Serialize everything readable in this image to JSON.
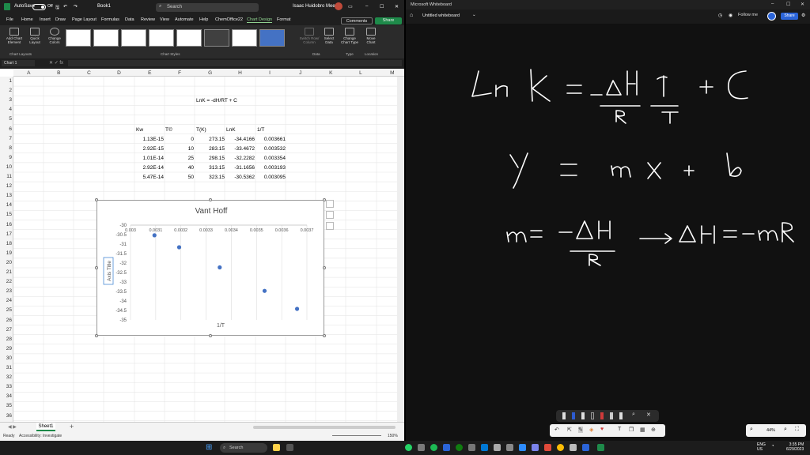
{
  "excel": {
    "autosave_label": "AutoSave",
    "toggle_state": "Off",
    "book_title": "Book1",
    "search_placeholder": "Search",
    "user_name": "Isaac Huidobro Meezs",
    "menu": [
      "File",
      "Home",
      "Insert",
      "Draw",
      "Page Layout",
      "Formulas",
      "Data",
      "Review",
      "View",
      "Automate",
      "Help",
      "ChemOffice22",
      "Chart Design",
      "Format"
    ],
    "active_menu": "Chart Design",
    "comments_label": "Comments",
    "share_label": "Share",
    "ribbon": {
      "add_chart_element": "Add Chart\nElement",
      "quick_layout": "Quick\nLayout",
      "change_colors": "Change\nColors",
      "switch_row_col": "Switch Row/\nColumn",
      "select_data": "Select\nData",
      "change_chart_type": "Change\nChart Type",
      "move_chart": "Move\nChart",
      "groups": [
        "Chart Layouts",
        "Chart Styles",
        "Data",
        "Type",
        "Location"
      ]
    },
    "namebox": "Chart 1",
    "columns": [
      "A",
      "B",
      "C",
      "D",
      "E",
      "F",
      "G",
      "H",
      "I",
      "J",
      "K",
      "L",
      "M"
    ],
    "rows": [
      "1",
      "2",
      "3",
      "4",
      "5",
      "6",
      "7",
      "8",
      "9",
      "10",
      "11",
      "12",
      "13",
      "14",
      "15",
      "16",
      "17",
      "18",
      "19",
      "20",
      "21",
      "22",
      "23",
      "24",
      "25",
      "26",
      "27",
      "28",
      "29",
      "30",
      "31",
      "32",
      "33",
      "34",
      "35",
      "36"
    ],
    "equation": "LnK = -dH/RT + C",
    "table_headers": [
      "Kw",
      "T©",
      "T(K)",
      "LnK",
      "1/T"
    ],
    "table_rows": [
      [
        "1.13E-15",
        "0",
        "273.15",
        "-34.4166",
        "0.003661"
      ],
      [
        "2.92E-15",
        "10",
        "283.15",
        "-33.4672",
        "0.003532"
      ],
      [
        "1.01E-14",
        "25",
        "298.15",
        "-32.2282",
        "0.003354"
      ],
      [
        "2.92E-14",
        "40",
        "313.15",
        "-31.1656",
        "0.003193"
      ],
      [
        "5.47E-14",
        "50",
        "323.15",
        "-30.5362",
        "0.003095"
      ]
    ],
    "sheet_tab": "Sheet1",
    "status_ready": "Ready",
    "status_accessibility": "Accessibility: Investigate",
    "zoom": "150%"
  },
  "chart_data": {
    "type": "scatter",
    "title": "Vant Hoff",
    "xlabel": "1/T",
    "ylabel": "Axis Title",
    "x_ticks": [
      "0.003",
      "0.0031",
      "0.0032",
      "0.0033",
      "0.0034",
      "0.0035",
      "0.0036",
      "0.0037"
    ],
    "y_ticks": [
      "-30",
      "-30.5",
      "-31",
      "-31.5",
      "-32",
      "-32.5",
      "-33",
      "-33.5",
      "-34",
      "-34.5",
      "-35"
    ],
    "xlim": [
      0.003,
      0.0037
    ],
    "ylim": [
      -35,
      -30
    ],
    "x": [
      0.003095,
      0.003193,
      0.003354,
      0.003532,
      0.003661
    ],
    "y": [
      -30.5362,
      -31.1656,
      -32.2282,
      -33.4672,
      -34.4166
    ],
    "y_inverted_tick_labels": true,
    "grid": true,
    "marker_color": "#4472c4"
  },
  "whiteboard": {
    "window_title": "Microsoft Whiteboard",
    "board_title": "Untitled whiteboard",
    "follow_label": "Follow me",
    "share_label": "Share",
    "zoom": "44%",
    "ink_lines": [
      "Ln K = -ΔH/R · 1/T + C",
      "y = m x + b",
      "m = -ΔH/R → ΔH = -mR"
    ]
  },
  "taskbar": {
    "search_label": "Search",
    "time": "3:35 PM",
    "date": "6/29/2023",
    "lang": "ENG",
    "region": "US"
  }
}
